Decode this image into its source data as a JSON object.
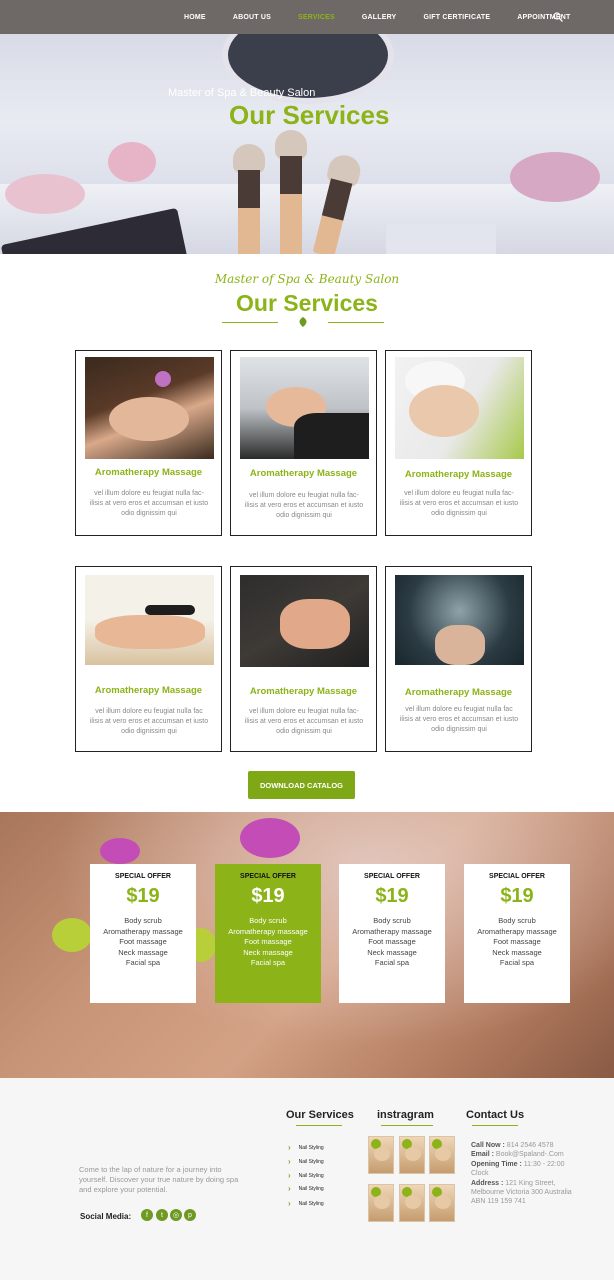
{
  "nav": {
    "items": [
      "HOME",
      "ABOUT US",
      "SERVICES",
      "GALLERY",
      "GIFT CERTIFICATE",
      "APPOINTMENT"
    ],
    "active": "SERVICES",
    "search_icon": "search-icon"
  },
  "hero": {
    "subtitle": "Master of Spa & Beauty Salon",
    "title": "Our Services"
  },
  "services_section": {
    "script_title": "Master of Spa & Beauty Salon",
    "title": "Our Services",
    "divider_icon": "leaf-icon",
    "cards": [
      {
        "title": "Aromatherapy Massage",
        "desc": "vel illum dolore eu feugiat nulla fac-ilisis at vero eros et accumsan et iusto odio dignissim qui"
      },
      {
        "title": "Aromatherapy Massage",
        "desc": "vel illum dolore eu feugiat nulla fac-ilisis at vero eros et accumsan et iusto odio dignissim qui"
      },
      {
        "title": "Aromatherapy Massage",
        "desc": "vel illum dolore eu feugiat nulla fac-ilisis at vero eros et accumsan et iusto odio dignissim qui"
      },
      {
        "title": "Aromatherapy Massage",
        "desc": "vel illum dolore eu feugiat nulla fac ilisis at vero eros et accumsan et iusto odio dignissim qui"
      },
      {
        "title": "Aromatherapy Massage",
        "desc": "vel illum dolore eu feugiat nulla fac-ilisis at vero eros et accumsan et iusto odio dignissim qui"
      },
      {
        "title": "Aromatherapy Massage",
        "desc": "vel illum dolore eu feugiat nulla fac ilisis at vero eros et accumsan et iusto odio dignissim qui"
      }
    ],
    "button_label": "DOWNLOAD CATALOG"
  },
  "offers": [
    {
      "label": "SPECIAL OFFER",
      "price": "$19",
      "items": [
        "Body scrub",
        "Aromatherapy massage",
        "Foot massage",
        "Neck massage",
        "Facial spa"
      ],
      "highlight": false
    },
    {
      "label": "SPECIAL OFFER",
      "price": "$19",
      "items": [
        "Body scrub",
        "Aromatherapy massage",
        "Foot massage",
        "Neck massage",
        "Facial spa"
      ],
      "highlight": true
    },
    {
      "label": "SPECIAL OFFER",
      "price": "$19",
      "items": [
        "Body scrub",
        "Aromatherapy massage",
        "Foot massage",
        "Neck massage",
        "Facial spa"
      ],
      "highlight": false
    },
    {
      "label": "SPECIAL OFFER",
      "price": "$19",
      "items": [
        "Body scrub",
        "Aromatherapy massage",
        "Foot massage",
        "Neck massage",
        "Facial spa"
      ],
      "highlight": false
    }
  ],
  "footer": {
    "about": "Come to the lap of nature for a journey into yourself. Discover your true nature by doing spa and explore your potential.",
    "social_label": "Social Media:",
    "social_icons": [
      "facebook-icon",
      "twitter-icon",
      "instagram-icon",
      "pinterest-icon"
    ],
    "services_heading": "Our Services",
    "services_items": [
      "Nail Styling",
      "Nail Styling",
      "Nail Styling",
      "Nail Styling",
      "Nail Styling"
    ],
    "instagram_heading": "instragram",
    "contact_heading": "Contact Us",
    "contact": {
      "call_label": "Call Now :",
      "call_value": "814 2546 4578",
      "email_label": "Email :",
      "email_value": "Book@Spaland-.Com",
      "hours_label": "Opening Time :",
      "hours_value": "11:30 - 22:00 Clock",
      "address_label": "Address :",
      "address_value": "121 King Street, Melbourne Victoria 300 Australia ABN 119 159 741"
    }
  },
  "colors": {
    "accent": "#8cb318",
    "nav_bg": "#6e6866"
  }
}
